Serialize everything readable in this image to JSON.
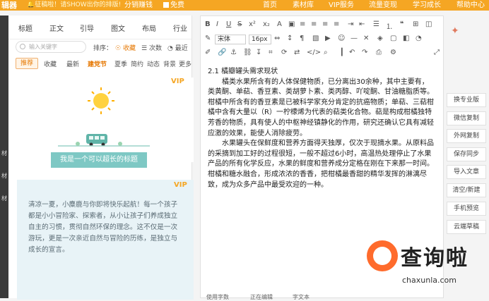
{
  "topbar": {
    "brand": "辑器",
    "notice": "🔔征稿啦！请SHOW出你的排版!",
    "earn": "分销赚钱",
    "free": "免费",
    "nav": [
      "首页",
      "素材库",
      "VIP服务",
      "流量变现",
      "学习成长",
      "帮助中心"
    ]
  },
  "left": {
    "tabs": [
      "标题",
      "正文",
      "引导",
      "图文",
      "布局",
      "行业"
    ],
    "search_placeholder": "输入关键字",
    "sort_label": "排序：",
    "sort_options": [
      "收藏",
      "次数",
      "最近"
    ],
    "filters": [
      "推荐",
      "收藏",
      "最新",
      "建党节",
      "夏季",
      "简约",
      "动态",
      "背景",
      "更多"
    ],
    "vip": "VIP",
    "banner_text": "我是一个可以超长的标题",
    "card_text": "清凉一夏，小麋鹿与你即将快乐起航！每一个孩子都是小小冒险家、探索者，从小让孩子们养成独立自主的习惯，贯彻自然环保的理念。这不仅是一次游玩，更是一次亲近自然与冒险的历练，是独立与成长的宣言。"
  },
  "edge_chars": [
    "材",
    "材",
    "材"
  ],
  "editor": {
    "font_family": "宋体",
    "font_size": "16px",
    "heading": "2.1 橘瓣罐头需求现状",
    "paragraphs": [
      "橘类水果所含有的人体保健物质，已分离出30余种，其中主要有，类黄酮、单萜、香豆素、类胡萝卜素、类丙醇、吖啶酮、甘油糖脂质等。柑橘中所含有的香豆素是已被科学家充分肯定的抗癌物质；单萜、三萜柑橘中含有大量以（R）一柠檬烯为代表的萜类化合物。萜是构成柑橘独特芳香的物质，具有使人的中枢神经镇静化的作用，研究还确认它具有减轻应激的效果，能使人消除疲劳。",
      "水果罐头在保鲜度和营养方面得天独厚，仅次于现摘水果。从原料品的采摘到加工好的过程很短，一般不超过6小时，高温热处理停止了水果产品的所有化学反应，水果的鲜度和营养成分定格在刚在下来那一时间。柑橘和糖水融合，形成浓浓的香香，把柑橘最香甜的精华发挥的淋漓尽致，成为众多产品中最受欢迎的一种。"
    ],
    "status": [
      "使用字数",
      "正在编辑",
      "字文本"
    ]
  },
  "right_buttons": [
    "换专业版",
    "微信复制",
    "外网复制",
    "保存同步",
    "导入文章",
    "清空/新建",
    "手机预览",
    "云端草稿"
  ],
  "watermark": {
    "title": "查询啦",
    "url": "chaxunla.com"
  },
  "colors": {
    "accent": "#f5a623",
    "banner": "#7ec8c4",
    "watermark_orange": "#ff6b2c",
    "card_bg": "#e8f3f7"
  }
}
